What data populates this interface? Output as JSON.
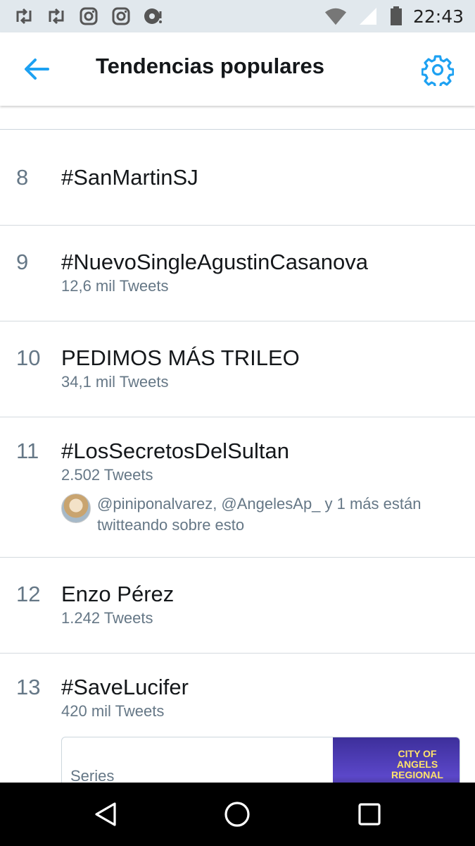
{
  "status_bar": {
    "time": "22:43",
    "left_icons": [
      "retweet-icon",
      "retweet-icon",
      "instagram-icon",
      "instagram-icon",
      "podcast-icon"
    ],
    "right_icons": [
      "wifi-icon",
      "signal-icon",
      "battery-icon"
    ]
  },
  "header": {
    "title": "Tendencias populares",
    "back_icon": "arrow-left-icon",
    "settings_icon": "gear-icon",
    "accent": "#1da1f2"
  },
  "trends": [
    {
      "rank": "8",
      "name": "#SanMartinSJ",
      "count": ""
    },
    {
      "rank": "9",
      "name": "#NuevoSingleAgustinCasanova",
      "count": "12,6 mil Tweets"
    },
    {
      "rank": "10",
      "name": "PEDIMOS MÁS TRILEO",
      "count": "34,1 mil Tweets"
    },
    {
      "rank": "11",
      "name": "#LosSecretosDelSultan",
      "count": "2.502 Tweets",
      "context": "@piniponalvarez, @AngelesAp_ y 1 más están twitteando sobre esto"
    },
    {
      "rank": "12",
      "name": "Enzo Pérez",
      "count": "1.242 Tweets"
    },
    {
      "rank": "13",
      "name": "#SaveLucifer",
      "count": "420 mil Tweets",
      "card": {
        "label": "Series",
        "image_text": "CITY OF ANGELS REGIONAL"
      }
    }
  ],
  "nav_bar": {
    "back_icon": "triangle-back-icon",
    "home_icon": "circle-home-icon",
    "recents_icon": "square-recents-icon"
  }
}
